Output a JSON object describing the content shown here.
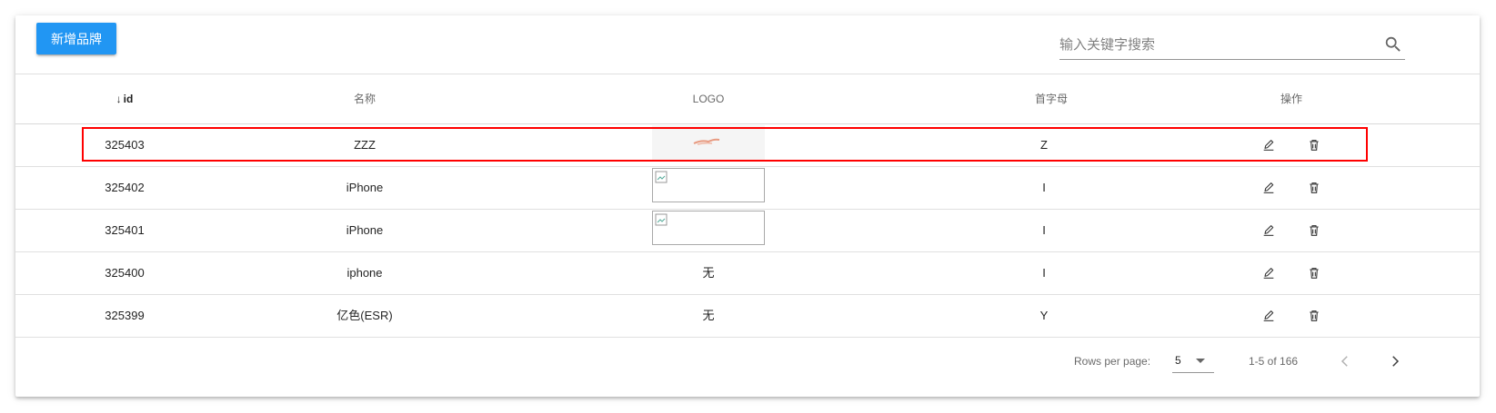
{
  "toolbar": {
    "add_label": "新增品牌",
    "search_placeholder": "输入关键字搜索",
    "search_value": ""
  },
  "table": {
    "sort_column": "id",
    "sort_direction": "descending",
    "headers": [
      "id",
      "名称",
      "LOGO",
      "首字母",
      "操作"
    ],
    "rows": [
      {
        "id": "325403",
        "name": "ZZZ",
        "logo": "image",
        "letter": "Z",
        "selected": true
      },
      {
        "id": "325402",
        "name": "iPhone",
        "logo": "broken-image",
        "letter": "I"
      },
      {
        "id": "325401",
        "name": "iPhone",
        "logo": "broken-image",
        "letter": "I"
      },
      {
        "id": "325400",
        "name": "iphone",
        "logo": "无",
        "letter": "I"
      },
      {
        "id": "325399",
        "name": "亿色(ESR)",
        "logo": "无",
        "letter": "Y"
      }
    ]
  },
  "pagination": {
    "rows_per_page_label": "Rows per page:",
    "rows_per_page": "5",
    "range_text": "1-5 of 166"
  },
  "icons": {
    "sort": "arrow-down-icon",
    "search": "search-icon",
    "edit": "pencil-icon",
    "delete": "trash-icon",
    "prev": "chevron-left-icon",
    "next": "chevron-right-icon"
  },
  "colors": {
    "primary": "#2196f3",
    "highlight": "#ff0000"
  }
}
